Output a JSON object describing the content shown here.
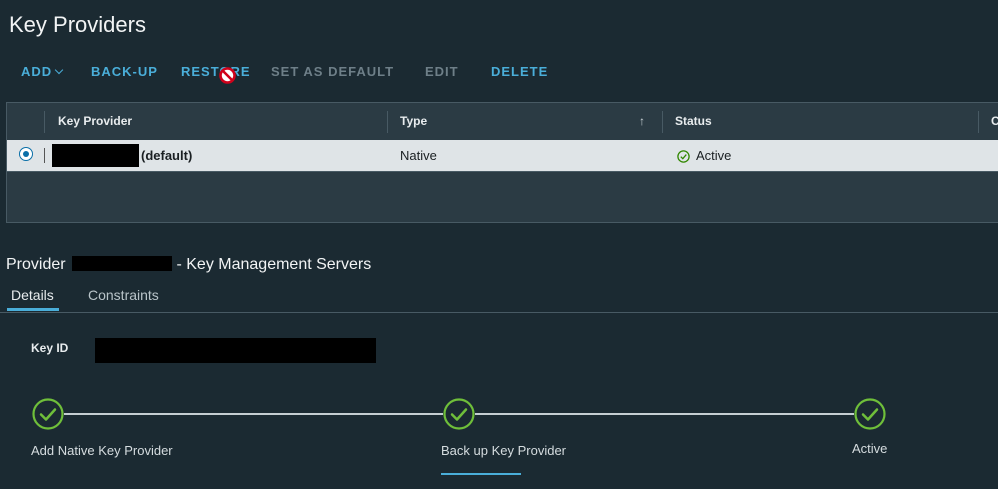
{
  "page": {
    "title": "Key Providers"
  },
  "toolbar": {
    "add_label": "ADD",
    "backup_label": "BACK-UP",
    "restore_label": "RESTORE",
    "set_default_label": "SET AS DEFAULT",
    "edit_label": "EDIT",
    "delete_label": "DELETE"
  },
  "grid": {
    "columns": [
      "Key Provider",
      "Type",
      "Status",
      "C"
    ],
    "rows": [
      {
        "name_suffix": "(default)",
        "type": "Native",
        "status": "Active"
      }
    ]
  },
  "provider": {
    "prefix": "Provider",
    "suffix": "- Key Management Servers"
  },
  "tabs": [
    "Details",
    "Constraints"
  ],
  "details": {
    "key_id_label": "Key ID"
  },
  "steps": [
    "Add Native Key Provider",
    "Back up Key Provider",
    "Active"
  ],
  "colors": {
    "accent": "#4aaed9",
    "success": "#6fbf3a",
    "disabled": "#6e7f88"
  }
}
